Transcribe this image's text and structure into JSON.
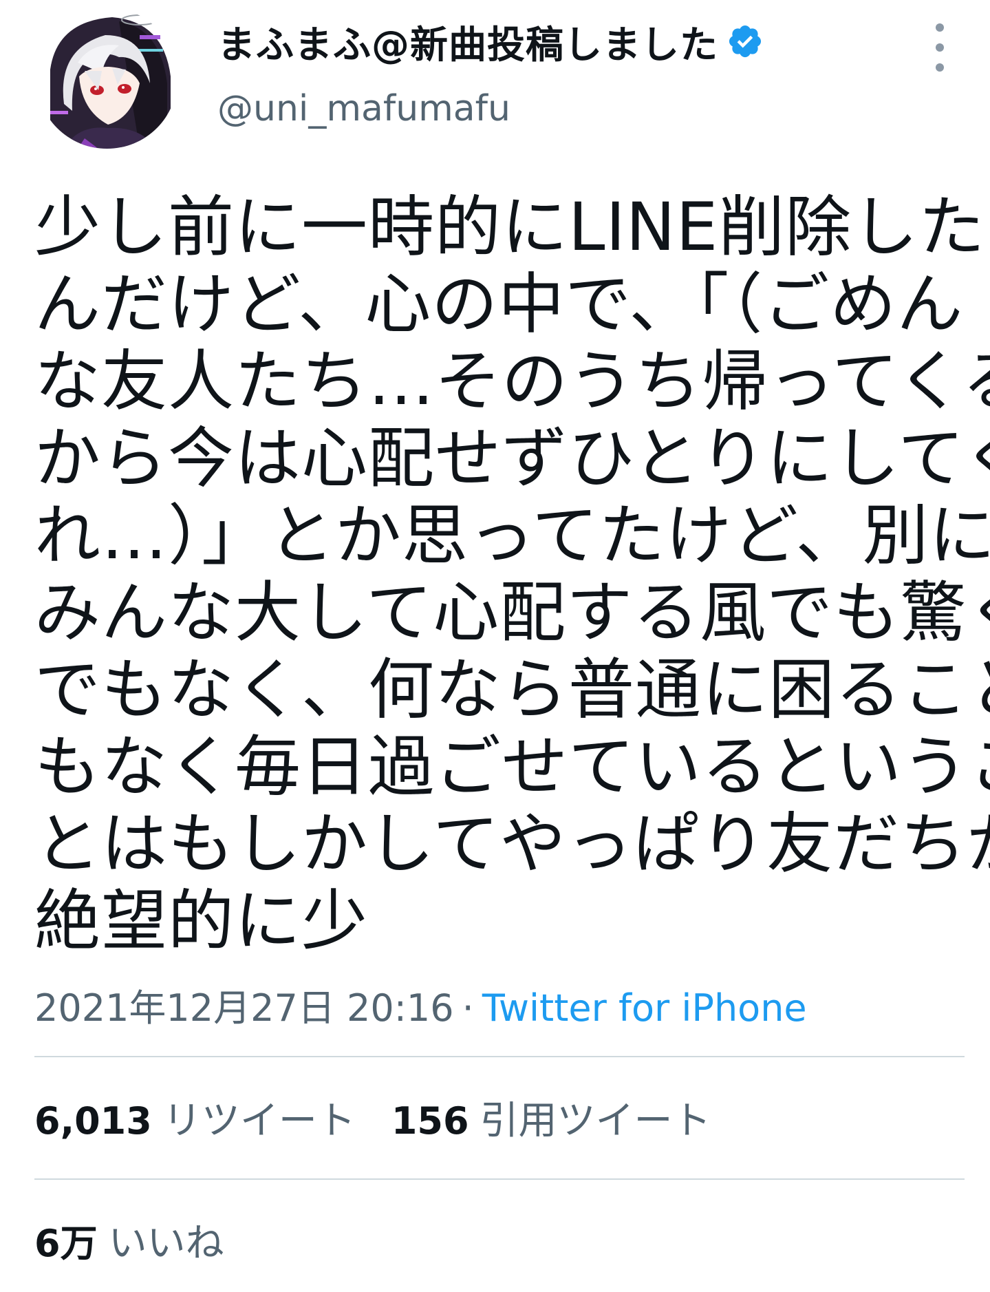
{
  "user": {
    "display_name": "まふまふ@新曲投稿しました",
    "handle": "@uni_mafumafu",
    "verified": true
  },
  "tweet": {
    "lines": [
      "少し前に一時的にLINE削除した",
      "んだけど、心の中で、「（ごめん",
      "な友人たち…そのうち帰ってくる",
      "から今は心配せずひとりにしてく",
      "れ…）」とか思ってたけど、別に",
      "みんな大して心配する風でも驚く",
      "でもなく、何なら普通に困ること",
      "もなく毎日過ごせているというこ",
      "とはもしかしてやっぱり友だちが",
      "絶望的に少"
    ]
  },
  "meta": {
    "timestamp": "2021年12月27日 20:16",
    "separator": "·",
    "source": "Twitter for iPhone"
  },
  "stats": {
    "retweets": {
      "count": "6,013",
      "label": "リツイート"
    },
    "quotes": {
      "count": "156",
      "label": "引用ツイート"
    },
    "likes": {
      "count": "6万",
      "label": "いいね"
    }
  },
  "colors": {
    "verified": "#1d9bf0",
    "link": "#1d9bf0",
    "secondary_text": "#536471",
    "divider": "#cfd9de"
  },
  "icons": {
    "verified": "verified-badge-icon",
    "more": "more-vertical-icon"
  }
}
